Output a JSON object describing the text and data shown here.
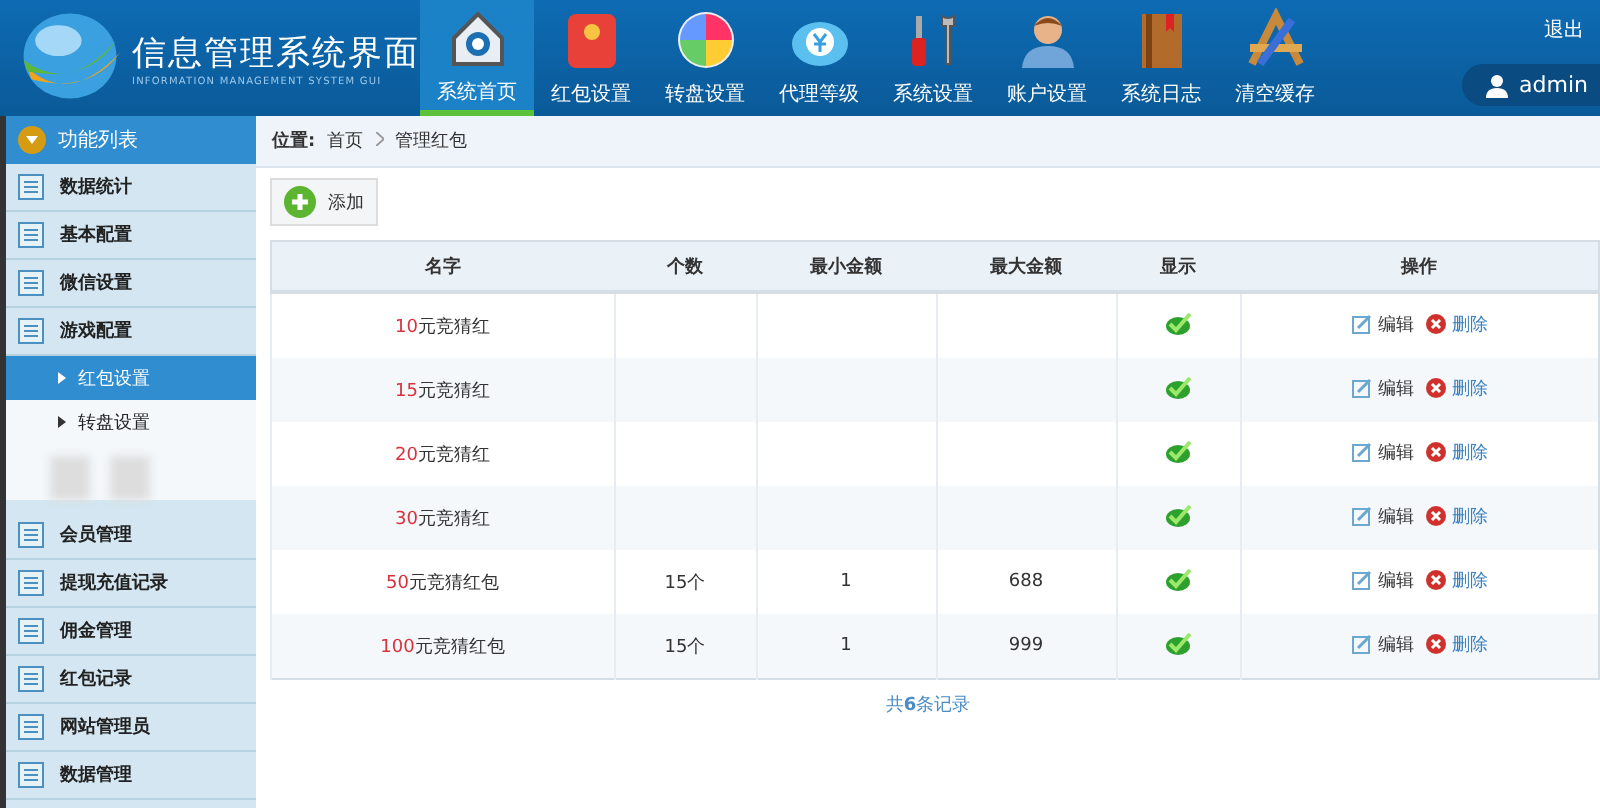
{
  "header": {
    "title": "信息管理系统界面",
    "subtitle": "INFORMATION MANAGEMENT SYSTEM GUI",
    "logout": "退出",
    "user": "admin"
  },
  "nav": [
    {
      "label": "系统首页",
      "selected": true
    },
    {
      "label": "红包设置",
      "selected": false
    },
    {
      "label": "转盘设置",
      "selected": false
    },
    {
      "label": "代理等级",
      "selected": false
    },
    {
      "label": "系统设置",
      "selected": false
    },
    {
      "label": "账户设置",
      "selected": false
    },
    {
      "label": "系统日志",
      "selected": false
    },
    {
      "label": "清空缓存",
      "selected": false
    }
  ],
  "sidebar": {
    "title": "功能列表",
    "items": [
      {
        "label": "数据统计"
      },
      {
        "label": "基本配置"
      },
      {
        "label": "微信设置"
      },
      {
        "label": "游戏配置",
        "children": [
          {
            "label": "红包设置",
            "selected": true
          },
          {
            "label": "转盘设置",
            "selected": false
          }
        ]
      },
      {
        "label": "会员管理"
      },
      {
        "label": "提现充值记录"
      },
      {
        "label": "佣金管理"
      },
      {
        "label": "红包记录"
      },
      {
        "label": "网站管理员"
      },
      {
        "label": "数据管理"
      }
    ]
  },
  "breadcrumb": {
    "label": "位置:",
    "items": [
      "首页",
      "管理红包"
    ]
  },
  "add_button": "添加",
  "table": {
    "columns": [
      "名字",
      "个数",
      "最小金额",
      "最大金额",
      "显示",
      "操作"
    ],
    "rows": [
      {
        "amount": "10",
        "name_rest": "元竞猜红",
        "shown": true,
        "edit": "编辑",
        "delete": "删除"
      },
      {
        "amount": "15",
        "name_rest": "元竞猜红",
        "shown": true,
        "edit": "编辑",
        "delete": "删除"
      },
      {
        "amount": "20",
        "name_rest": "元竞猜红",
        "shown": true,
        "edit": "编辑",
        "delete": "删除"
      },
      {
        "amount": "30",
        "name_rest": "元竞猜红",
        "shown": true,
        "edit": "编辑",
        "delete": "删除"
      },
      {
        "amount": "50",
        "name_rest": "元竞猜红包",
        "count": "15个",
        "min": "1",
        "max": "688",
        "shown": true,
        "edit": "编辑",
        "delete": "删除"
      },
      {
        "amount": "100",
        "name_rest": "元竞猜红包",
        "count": "15个",
        "min": "1",
        "max": "999",
        "shown": true,
        "edit": "编辑",
        "delete": "删除"
      }
    ]
  },
  "footer": "共**6**条记录"
}
